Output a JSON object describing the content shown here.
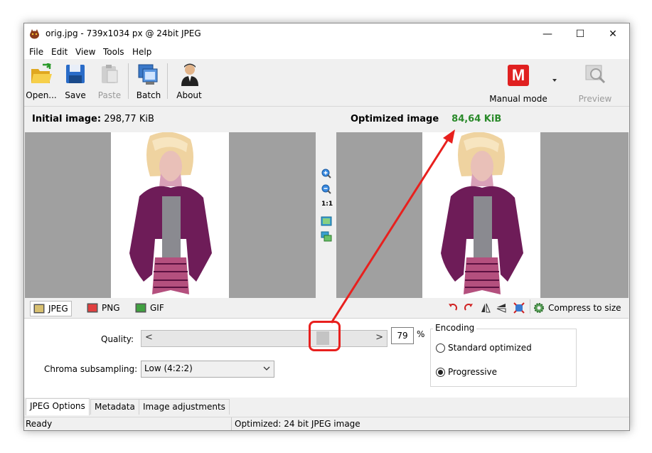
{
  "window": {
    "title": "orig.jpg - 739x1034 px @ 24bit JPEG"
  },
  "controls": {
    "minimize": "—",
    "maximize": "☐",
    "close": "✕"
  },
  "menu": [
    "File",
    "Edit",
    "View",
    "Tools",
    "Help"
  ],
  "toolbar": {
    "open": "Open...",
    "save": "Save",
    "paste": "Paste",
    "batch": "Batch",
    "about": "About",
    "mode_letter": "M",
    "mode": "Manual mode",
    "preview": "Preview"
  },
  "images": {
    "initial_label": "Initial image:",
    "initial_size": "298,77 KiB",
    "optimized_label": "Optimized image",
    "optimized_size": "84,64 KiB"
  },
  "zoom": {
    "one_to_one": "1:1"
  },
  "format_tabs": [
    "JPEG",
    "PNG",
    "GIF"
  ],
  "compress": "Compress to size",
  "jpeg_options": {
    "quality_label": "Quality:",
    "quality_value": "79",
    "percent": "%",
    "slider_left": "<",
    "slider_right": ">",
    "chroma_label": "Chroma subsampling:",
    "chroma_value": "Low (4:2:2)",
    "encoding_title": "Encoding",
    "standard": "Standard optimized",
    "progressive": "Progressive"
  },
  "bottom_tabs": [
    "JPEG Options",
    "Metadata",
    "Image adjustments"
  ],
  "status": {
    "left": "Ready",
    "right": "Optimized: 24 bit JPEG image"
  },
  "colors": {
    "optimized_size": "#2a8a2a",
    "mode_icon": "#e02020",
    "annotation": "#e8201e"
  }
}
